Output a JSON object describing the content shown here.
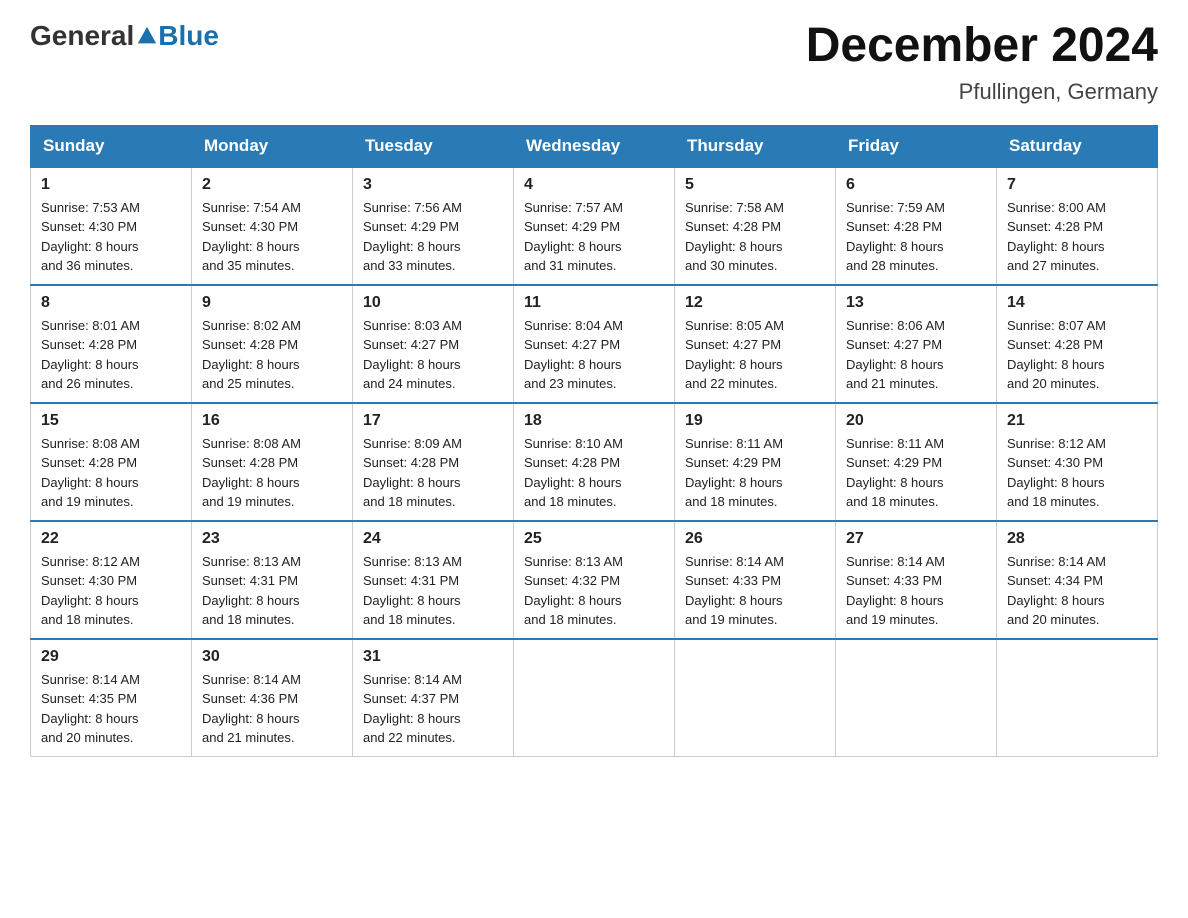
{
  "header": {
    "logo_general": "General",
    "logo_blue": "Blue",
    "title": "December 2024",
    "location": "Pfullingen, Germany"
  },
  "days_of_week": [
    "Sunday",
    "Monday",
    "Tuesday",
    "Wednesday",
    "Thursday",
    "Friday",
    "Saturday"
  ],
  "weeks": [
    [
      {
        "day": "1",
        "sunrise": "7:53 AM",
        "sunset": "4:30 PM",
        "daylight": "8 hours and 36 minutes."
      },
      {
        "day": "2",
        "sunrise": "7:54 AM",
        "sunset": "4:30 PM",
        "daylight": "8 hours and 35 minutes."
      },
      {
        "day": "3",
        "sunrise": "7:56 AM",
        "sunset": "4:29 PM",
        "daylight": "8 hours and 33 minutes."
      },
      {
        "day": "4",
        "sunrise": "7:57 AM",
        "sunset": "4:29 PM",
        "daylight": "8 hours and 31 minutes."
      },
      {
        "day": "5",
        "sunrise": "7:58 AM",
        "sunset": "4:28 PM",
        "daylight": "8 hours and 30 minutes."
      },
      {
        "day": "6",
        "sunrise": "7:59 AM",
        "sunset": "4:28 PM",
        "daylight": "8 hours and 28 minutes."
      },
      {
        "day": "7",
        "sunrise": "8:00 AM",
        "sunset": "4:28 PM",
        "daylight": "8 hours and 27 minutes."
      }
    ],
    [
      {
        "day": "8",
        "sunrise": "8:01 AM",
        "sunset": "4:28 PM",
        "daylight": "8 hours and 26 minutes."
      },
      {
        "day": "9",
        "sunrise": "8:02 AM",
        "sunset": "4:28 PM",
        "daylight": "8 hours and 25 minutes."
      },
      {
        "day": "10",
        "sunrise": "8:03 AM",
        "sunset": "4:27 PM",
        "daylight": "8 hours and 24 minutes."
      },
      {
        "day": "11",
        "sunrise": "8:04 AM",
        "sunset": "4:27 PM",
        "daylight": "8 hours and 23 minutes."
      },
      {
        "day": "12",
        "sunrise": "8:05 AM",
        "sunset": "4:27 PM",
        "daylight": "8 hours and 22 minutes."
      },
      {
        "day": "13",
        "sunrise": "8:06 AM",
        "sunset": "4:27 PM",
        "daylight": "8 hours and 21 minutes."
      },
      {
        "day": "14",
        "sunrise": "8:07 AM",
        "sunset": "4:28 PM",
        "daylight": "8 hours and 20 minutes."
      }
    ],
    [
      {
        "day": "15",
        "sunrise": "8:08 AM",
        "sunset": "4:28 PM",
        "daylight": "8 hours and 19 minutes."
      },
      {
        "day": "16",
        "sunrise": "8:08 AM",
        "sunset": "4:28 PM",
        "daylight": "8 hours and 19 minutes."
      },
      {
        "day": "17",
        "sunrise": "8:09 AM",
        "sunset": "4:28 PM",
        "daylight": "8 hours and 18 minutes."
      },
      {
        "day": "18",
        "sunrise": "8:10 AM",
        "sunset": "4:28 PM",
        "daylight": "8 hours and 18 minutes."
      },
      {
        "day": "19",
        "sunrise": "8:11 AM",
        "sunset": "4:29 PM",
        "daylight": "8 hours and 18 minutes."
      },
      {
        "day": "20",
        "sunrise": "8:11 AM",
        "sunset": "4:29 PM",
        "daylight": "8 hours and 18 minutes."
      },
      {
        "day": "21",
        "sunrise": "8:12 AM",
        "sunset": "4:30 PM",
        "daylight": "8 hours and 18 minutes."
      }
    ],
    [
      {
        "day": "22",
        "sunrise": "8:12 AM",
        "sunset": "4:30 PM",
        "daylight": "8 hours and 18 minutes."
      },
      {
        "day": "23",
        "sunrise": "8:13 AM",
        "sunset": "4:31 PM",
        "daylight": "8 hours and 18 minutes."
      },
      {
        "day": "24",
        "sunrise": "8:13 AM",
        "sunset": "4:31 PM",
        "daylight": "8 hours and 18 minutes."
      },
      {
        "day": "25",
        "sunrise": "8:13 AM",
        "sunset": "4:32 PM",
        "daylight": "8 hours and 18 minutes."
      },
      {
        "day": "26",
        "sunrise": "8:14 AM",
        "sunset": "4:33 PM",
        "daylight": "8 hours and 19 minutes."
      },
      {
        "day": "27",
        "sunrise": "8:14 AM",
        "sunset": "4:33 PM",
        "daylight": "8 hours and 19 minutes."
      },
      {
        "day": "28",
        "sunrise": "8:14 AM",
        "sunset": "4:34 PM",
        "daylight": "8 hours and 20 minutes."
      }
    ],
    [
      {
        "day": "29",
        "sunrise": "8:14 AM",
        "sunset": "4:35 PM",
        "daylight": "8 hours and 20 minutes."
      },
      {
        "day": "30",
        "sunrise": "8:14 AM",
        "sunset": "4:36 PM",
        "daylight": "8 hours and 21 minutes."
      },
      {
        "day": "31",
        "sunrise": "8:14 AM",
        "sunset": "4:37 PM",
        "daylight": "8 hours and 22 minutes."
      },
      null,
      null,
      null,
      null
    ]
  ],
  "labels": {
    "sunrise": "Sunrise:",
    "sunset": "Sunset:",
    "daylight": "Daylight:"
  }
}
